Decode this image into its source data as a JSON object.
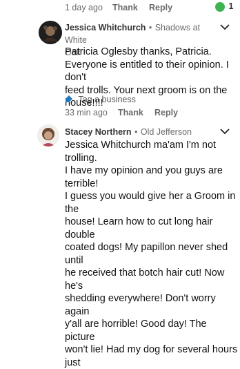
{
  "top_bar": {
    "time": "1 day ago",
    "thank": "Thank",
    "reply": "Reply",
    "thanks_count": "1"
  },
  "comments": [
    {
      "author": "Jessica Whitchurch",
      "separator": "•",
      "neighborhood_line1": "Shadows at White",
      "neighborhood_line2": "Oak",
      "lines": [
        "Patricia Oglesby thanks, Patricia.",
        "Everyone is entitled to their opinion.  I don't",
        "feed trolls.  Your next groom is on the",
        "house!!!!"
      ],
      "tag_business": "Tag a business",
      "time": "33 min ago",
      "thank": "Thank",
      "reply": "Reply"
    },
    {
      "author": "Stacey Northern",
      "separator": "•",
      "neighborhood": "Old Jefferson",
      "lines": [
        "Jessica Whitchurch ma'am I'm not trolling.",
        "I have my opinion and you guys are terrible!",
        "I guess you would give her a Groom in the",
        "house! Learn how to cut long hair double",
        "coated dogs! My papillon never shed until",
        "he received that botch hair cut! Now he's",
        "shedding everywhere! Don't worry again",
        "y'all are horrible! Good day! The picture",
        "won't lie! Had my dog for several hours just"
      ]
    }
  ],
  "colors": {
    "thanks_badge": "#3fb34f",
    "tag_icon": "#1f7ac2"
  }
}
